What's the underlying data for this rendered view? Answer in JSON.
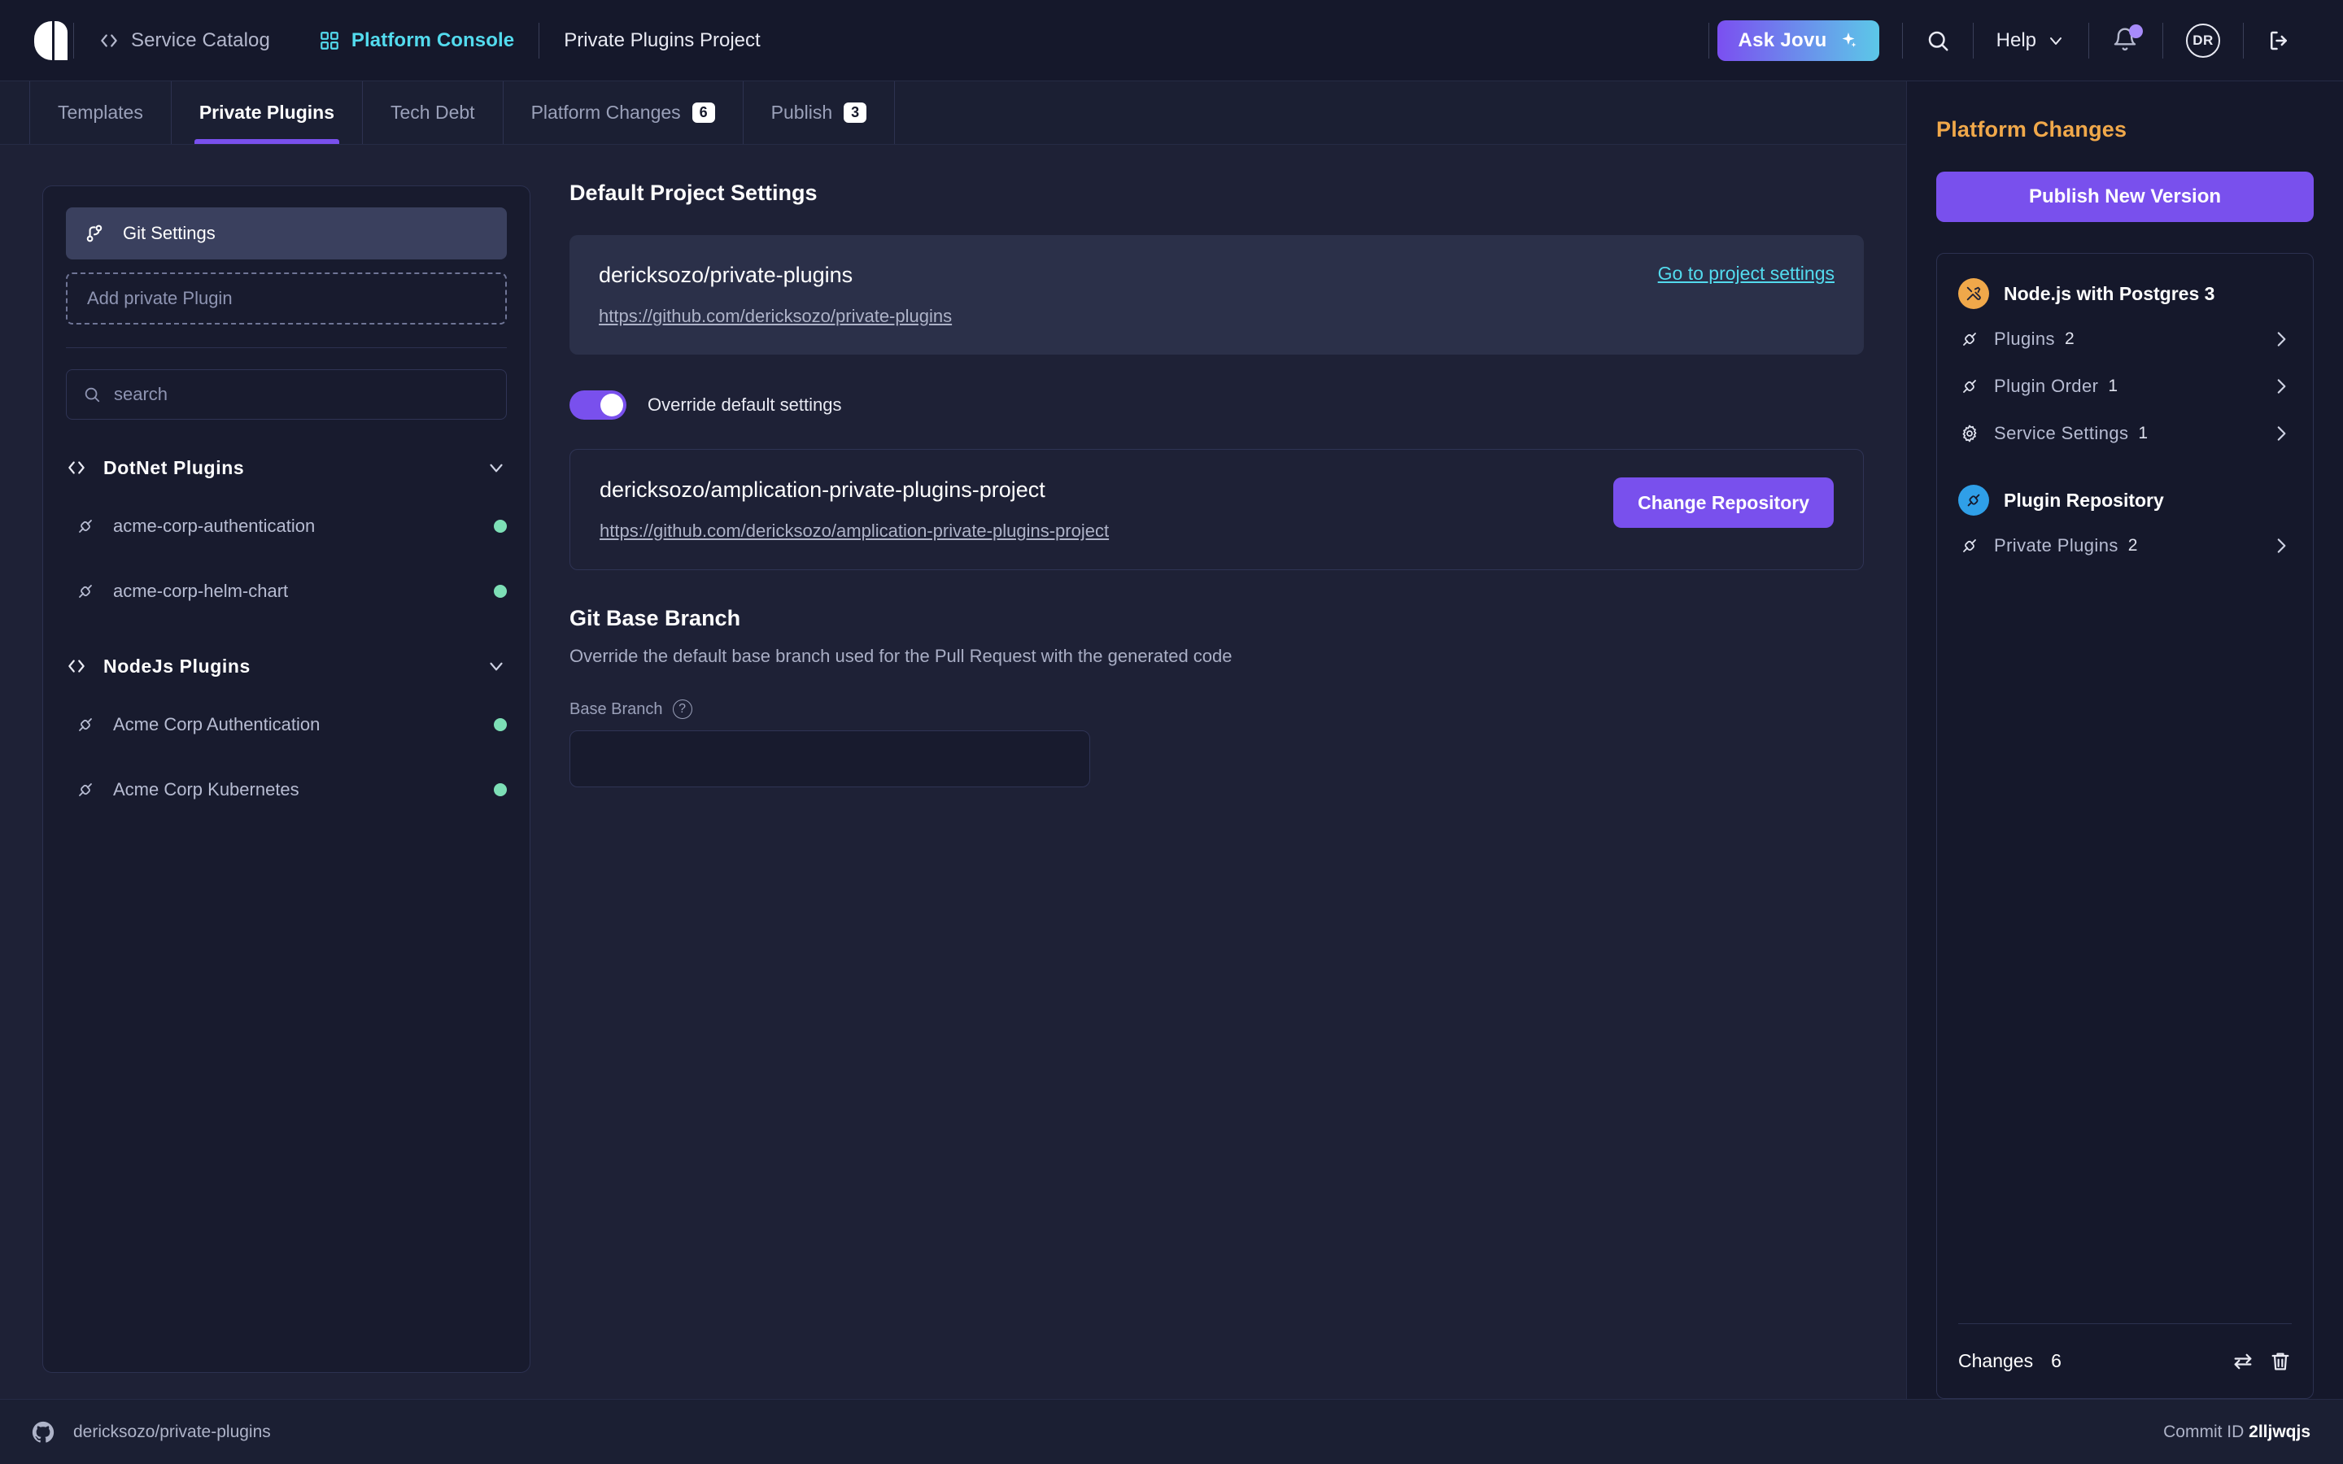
{
  "header": {
    "logo_name": "amplication-logo",
    "nav": [
      {
        "label": "Service Catalog",
        "icon": "code-brackets-icon",
        "active": false
      },
      {
        "label": "Platform Console",
        "icon": "grid-squares-icon",
        "active": true
      }
    ],
    "project_title": "Private Plugins Project",
    "ask_jovu_label": "Ask Jovu",
    "ask_jovu_icon": "sparkle-icon",
    "search_icon": "search-icon",
    "help_label": "Help",
    "help_caret_icon": "chevron-down-icon",
    "notifications_icon": "bell-icon",
    "avatar_initials": "DR",
    "logout_icon": "logout-icon"
  },
  "tabs": [
    {
      "label": "Templates",
      "badge": "",
      "active": false
    },
    {
      "label": "Private Plugins",
      "badge": "",
      "active": true
    },
    {
      "label": "Tech Debt",
      "badge": "",
      "active": false
    },
    {
      "label": "Platform Changes",
      "badge": "6",
      "active": false
    },
    {
      "label": "Publish",
      "badge": "3",
      "active": false
    }
  ],
  "plugins_panel": {
    "git_settings_label": "Git Settings",
    "git_settings_icon": "git-branch-icon",
    "add_plugin_label": "Add private Plugin",
    "search_placeholder": "search",
    "search_value": "",
    "search_icon": "search-icon",
    "groups": [
      {
        "name": "DotNet  Plugins",
        "icon": "code-brackets-icon",
        "chevron": "chevron-down-icon",
        "items": [
          {
            "label": "acme-corp-authentication",
            "icon": "plugin-icon",
            "status_color": "#7ddfb6"
          },
          {
            "label": "acme-corp-helm-chart",
            "icon": "plugin-icon",
            "status_color": "#7ddfb6"
          }
        ]
      },
      {
        "name": "NodeJs  Plugins",
        "icon": "code-brackets-icon",
        "chevron": "chevron-down-icon",
        "items": [
          {
            "label": "Acme Corp Authentication",
            "icon": "plugin-icon",
            "status_color": "#7ddfb6"
          },
          {
            "label": "Acme Corp Kubernetes",
            "icon": "plugin-icon",
            "status_color": "#7ddfb6"
          }
        ]
      }
    ]
  },
  "main": {
    "default_settings_title": "Default Project Settings",
    "default_repo": {
      "name": "dericksozo/private-plugins",
      "url": "https://github.com/dericksozo/private-plugins",
      "action_link": "Go to project settings"
    },
    "override_toggle_label": "Override default settings",
    "override_toggle_on": true,
    "override_repo": {
      "name": "dericksozo/amplication-private-plugins-project",
      "url": "https://github.com/dericksozo/amplication-private-plugins-project",
      "action_button": "Change Repository"
    },
    "git_base_branch": {
      "title": "Git Base Branch",
      "description": "Override the default base branch used for the Pull Request with the generated code",
      "field_label": "Base Branch",
      "help_icon": "question-mark-icon",
      "value": "",
      "placeholder": ""
    }
  },
  "right_panel": {
    "title": "Platform Changes",
    "publish_button": "Publish New Version",
    "resource": {
      "name": "Node.js with Postgres 3",
      "icon": "tools-icon",
      "icon_bg": "#f0a84a"
    },
    "resource_changes": [
      {
        "label": "Plugins",
        "count": "2",
        "icon": "plugin-icon",
        "chevron": "chevron-right-icon"
      },
      {
        "label": "Plugin Order",
        "count": "1",
        "icon": "plugin-icon",
        "chevron": "chevron-right-icon"
      },
      {
        "label": "Service Settings",
        "count": "1",
        "icon": "gear-icon",
        "chevron": "chevron-right-icon"
      }
    ],
    "repository": {
      "name": "Plugin Repository",
      "icon": "plugin-icon",
      "icon_bg": "#2f9fe8"
    },
    "repository_changes": [
      {
        "label": "Private Plugins",
        "count": "2",
        "icon": "plugin-icon",
        "chevron": "chevron-right-icon"
      }
    ],
    "footer": {
      "label": "Changes",
      "count": "6",
      "compare_icon": "compare-arrows-icon",
      "delete_icon": "trash-icon"
    }
  },
  "footer": {
    "repo_icon": "github-icon",
    "repo_label": "dericksozo/private-plugins",
    "commit_label": "Commit ID",
    "commit_id": "2lljwqjs"
  },
  "colors": {
    "accent_purple": "#7950ed",
    "accent_cyan": "#53dbee",
    "accent_orange": "#f0a84a",
    "status_green": "#7ddfb6",
    "bg_dark": "#15182b",
    "bg_main": "#1e2136",
    "card": "#2b3049"
  }
}
